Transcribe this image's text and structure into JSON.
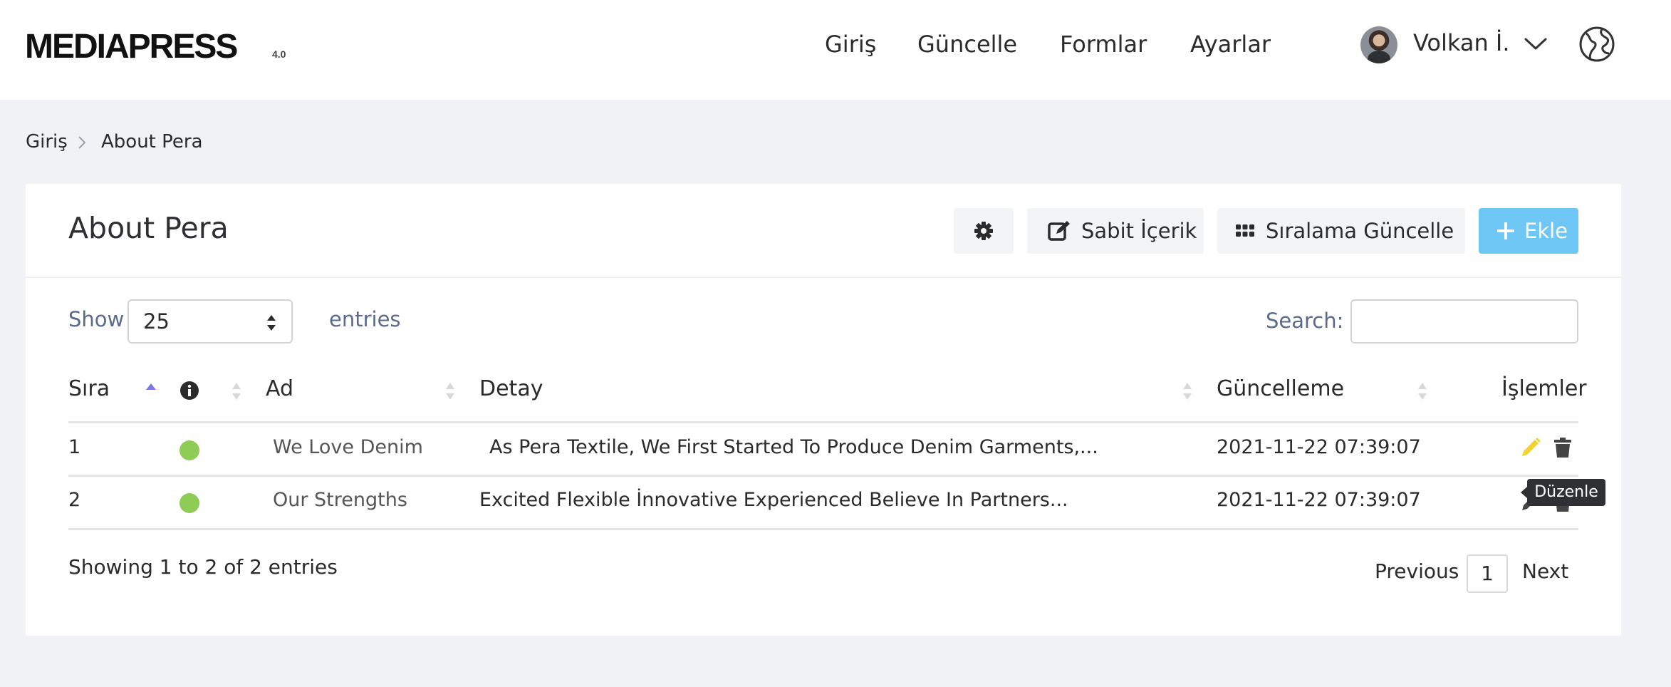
{
  "brand": {
    "name": "MEDIAPRESS",
    "version": "4.0"
  },
  "nav": {
    "items": [
      "Giriş",
      "Güncelle",
      "Formlar",
      "Ayarlar"
    ]
  },
  "user": {
    "name": "Volkan İ."
  },
  "breadcrumb": {
    "home": "Giriş",
    "current": "About Pera"
  },
  "page": {
    "title": "About Pera",
    "buttons": {
      "settings_icon": "gear-icon",
      "fixed_content": "Sabit İçerik",
      "update_order": "Sıralama Güncelle",
      "add": "Ekle"
    }
  },
  "table_controls": {
    "show_label": "Show",
    "page_size": "25",
    "entries_label": "entries",
    "search_label": "Search:",
    "search_value": ""
  },
  "table": {
    "columns": [
      "Sıra",
      "Ad",
      "Detay",
      "Güncelleme",
      "İşlemler"
    ],
    "rows": [
      {
        "order": "1",
        "status": "active",
        "name": "We Love Denim",
        "detail": "As Pera Textile, We First Started To Produce Denim Garments,...",
        "updated": "2021-11-22 07:39:07"
      },
      {
        "order": "2",
        "status": "active",
        "name": "Our Strengths",
        "detail": "Excited Flexible İnnovative Experienced Believe In Partners...",
        "updated": "2021-11-22 07:39:07"
      }
    ]
  },
  "footer": {
    "info": "Showing 1 to 2 of 2 entries",
    "previous": "Previous",
    "current_page": "1",
    "next": "Next"
  },
  "tooltip": {
    "text": "Düzenle"
  },
  "colors": {
    "accent_add": "#6ec6f5",
    "status_active": "#8fcc55",
    "edit_icon": "#f2d232",
    "label_muted": "#5b6a8c"
  }
}
